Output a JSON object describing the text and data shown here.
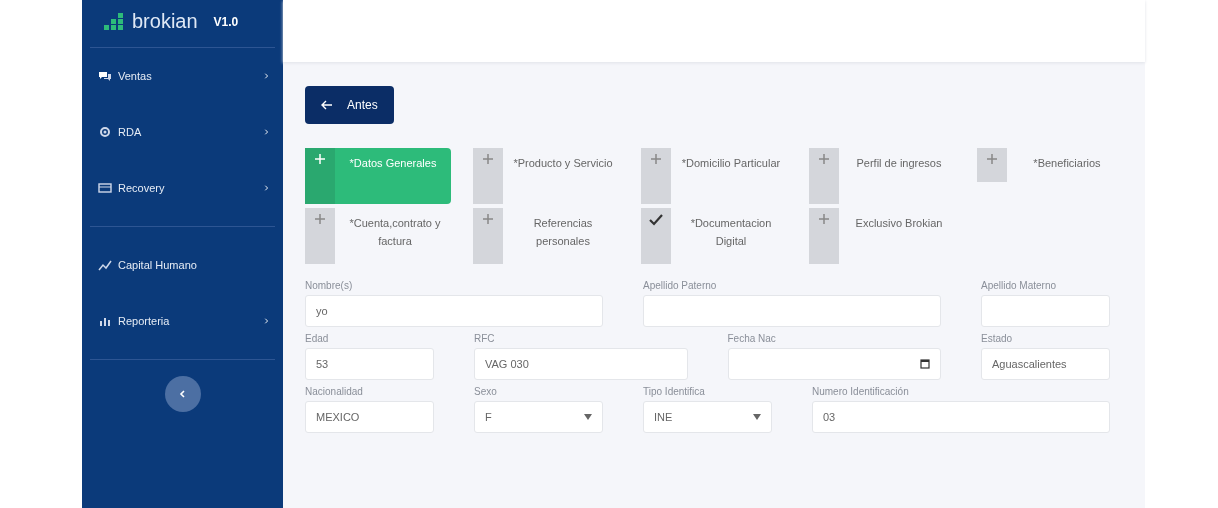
{
  "sidebar": {
    "brand": "brokian",
    "version": "V1.0",
    "items": [
      {
        "label": "Ventas",
        "has_arrow": true
      },
      {
        "label": "RDA",
        "has_arrow": true
      },
      {
        "label": "Recovery",
        "has_arrow": true
      },
      {
        "label": "Capital Humano",
        "has_arrow": false
      },
      {
        "label": "Reporteria",
        "has_arrow": true
      }
    ]
  },
  "back_button": {
    "label": "Antes"
  },
  "steps": [
    {
      "label": "*Datos Generales",
      "selected": true,
      "done": false
    },
    {
      "label": "*Producto y Servicio",
      "selected": false,
      "done": false
    },
    {
      "label": "*Domicilio Particular",
      "selected": false,
      "done": false
    },
    {
      "label": "Perfil de ingresos",
      "selected": false,
      "done": false
    },
    {
      "label": "*Beneficiarios",
      "selected": false,
      "done": false
    },
    {
      "label": "*Cuenta,contrato y factura",
      "selected": false,
      "done": false
    },
    {
      "label": "Referencias personales",
      "selected": false,
      "done": false
    },
    {
      "label": "*Documentacion Digital",
      "selected": false,
      "done": true
    },
    {
      "label": "Exclusivo Brokian",
      "selected": false,
      "done": false
    }
  ],
  "form_rows": [
    [
      {
        "label": "Nombre(s)",
        "value": "yo",
        "kind": "text"
      },
      {
        "label": "Apellido Paterno",
        "kind": "text"
      },
      {
        "label": "Apellido Materno",
        "kind": "text"
      }
    ],
    [
      {
        "label": "Edad",
        "value": "53",
        "kind": "text"
      },
      {
        "label": "RFC",
        "value": "VAG 030",
        "kind": "text"
      },
      {
        "label": "Fecha Nac",
        "kind": "date"
      },
      {
        "label": "Estado",
        "value": "Aguascalientes",
        "kind": "text"
      }
    ],
    [
      {
        "label": "Nacionalidad",
        "value": "MEXICO",
        "kind": "text"
      },
      {
        "label": "Sexo",
        "value": "F",
        "kind": "select"
      },
      {
        "label": "Tipo Identifica",
        "value": "INE",
        "kind": "select"
      },
      {
        "label": "Numero Identificación",
        "value": "03",
        "kind": "text"
      }
    ]
  ]
}
